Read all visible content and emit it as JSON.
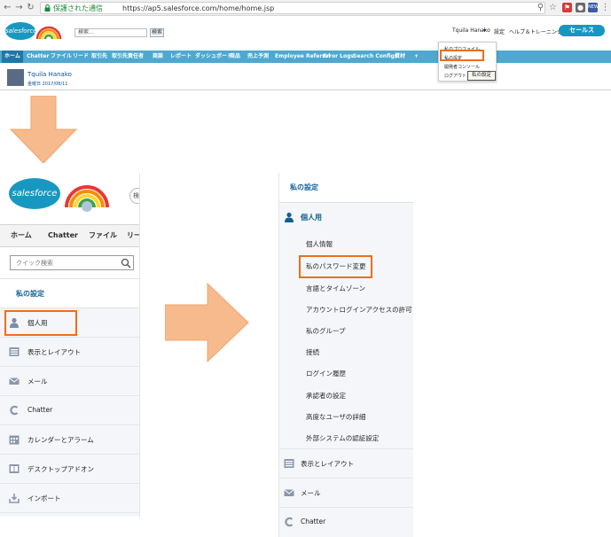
{
  "browser": {
    "secure_label": "保護された通信",
    "url": "https://ap5.salesforce.com/home/home.jsp",
    "ext_badge": "NEW"
  },
  "header": {
    "logo_text": "salesforce",
    "search_placeholder": "検索...",
    "search_button": "検索",
    "user_menu_label": "Tquila Hanako",
    "setup_link": "設定",
    "help_link": "ヘルプ＆トレーニング",
    "app_button": "セールス"
  },
  "top_tabs": [
    "ホーム",
    "Chatter",
    "ファイル",
    "リード",
    "取引先",
    "取引先責任者",
    "商談",
    "レポート",
    "ダッシュボード",
    "商品",
    "売上予測",
    "Employee Referral",
    "Error Logs",
    "Search Configs",
    "資材",
    "+"
  ],
  "user_row": {
    "name": "Tquila Hanako",
    "date": "金曜日 2017/08/11"
  },
  "user_dropdown": {
    "items": [
      "私のプロファイル",
      "私の設定",
      "開発者コンソール",
      "ログアウト"
    ],
    "tooltip": "私の設定"
  },
  "left_panel": {
    "logo_text": "salesforce",
    "search_cut": "検",
    "tabs": [
      "ホーム",
      "Chatter",
      "ファイル",
      "リー"
    ],
    "quick_search_placeholder": "クイック検索",
    "section_title": "私の設定",
    "items": [
      {
        "label": "個人用",
        "icon": "person-icon"
      },
      {
        "label": "表示とレイアウト",
        "icon": "layout-icon"
      },
      {
        "label": "メール",
        "icon": "mail-icon"
      },
      {
        "label": "Chatter",
        "icon": "chatter-icon"
      },
      {
        "label": "カレンダーとアラーム",
        "icon": "calendar-icon"
      },
      {
        "label": "デスクトップアドオン",
        "icon": "desktop-icon"
      },
      {
        "label": "インポート",
        "icon": "import-icon"
      }
    ]
  },
  "right_panel": {
    "section_title": "私の設定",
    "personal_label": "個人用",
    "sub_items": [
      "個人情報",
      "私のパスワード変更",
      "言語とタイムゾーン",
      "アカウントログインアクセスの許可",
      "私のグループ",
      "接続",
      "ログイン履歴",
      "承認者の設定",
      "高度なユーザの詳細",
      "外部システムの認証設定"
    ],
    "items": [
      {
        "label": "表示とレイアウト",
        "icon": "layout-icon"
      },
      {
        "label": "メール",
        "icon": "mail-icon"
      },
      {
        "label": "Chatter",
        "icon": "chatter-icon"
      }
    ]
  },
  "colors": {
    "highlight": "#ec6f1e",
    "arrow": "#f7ba8d",
    "brand": "#1798c1",
    "tabbar": "#4ea8cf",
    "link": "#0f5f94"
  }
}
